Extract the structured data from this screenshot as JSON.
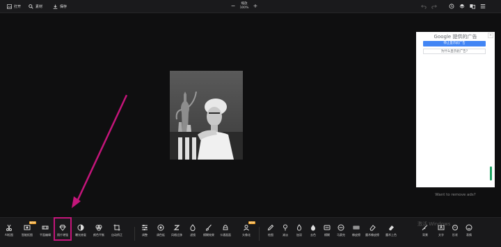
{
  "topbar": {
    "open_label": "打开",
    "material_label": "素材",
    "save_label": "保存",
    "zoom_label": "缩放",
    "zoom_value": "100%"
  },
  "ad": {
    "title": "Google 提供的广告",
    "stop_label": "停止显示此广告",
    "why_label": "为什么显示此广告?",
    "remove_text": "Want to remove ads?"
  },
  "toolbar": {
    "tools": [
      {
        "label": "AI抠图",
        "icon": "scissors-icon"
      },
      {
        "label": "智能抠图",
        "icon": "smart-cutout-icon",
        "badge": "NEW"
      },
      {
        "label": "平面编辑",
        "icon": "flat-edit-icon"
      },
      {
        "label": "照片增强",
        "icon": "diamond-icon"
      },
      {
        "label": "曝光修复",
        "icon": "exposure-icon"
      },
      {
        "label": "颜色平衡",
        "icon": "color-balance-icon"
      },
      {
        "label": "自动矫正",
        "icon": "crop-icon"
      },
      {
        "label": "调整",
        "icon": "sliders-icon"
      },
      {
        "label": "调色板",
        "icon": "palette-icon"
      },
      {
        "label": "风格迁移",
        "icon": "style-icon"
      },
      {
        "label": "滤镜",
        "icon": "drop-icon"
      },
      {
        "label": "模糊效果",
        "icon": "brush-icon"
      },
      {
        "label": "卡通画面",
        "icon": "cartoon-icon"
      },
      {
        "label": "头像化",
        "icon": "avatar-icon",
        "badge": "NEW"
      },
      {
        "label": "绘图",
        "icon": "pencil-icon"
      },
      {
        "label": "减淡",
        "icon": "dodge-icon"
      },
      {
        "label": "加深",
        "icon": "burn-icon"
      },
      {
        "label": "去色",
        "icon": "desaturate-icon"
      },
      {
        "label": "模糊",
        "icon": "blur-icon"
      },
      {
        "label": "马赛克",
        "icon": "mosaic-icon"
      },
      {
        "label": "橡皮擦",
        "icon": "eraser-icon"
      },
      {
        "label": "魔术橡皮擦",
        "icon": "magic-eraser-icon"
      },
      {
        "label": "魔术上色",
        "icon": "magic-color-icon"
      },
      {
        "label": "背景",
        "icon": "background-icon"
      },
      {
        "label": "文字",
        "icon": "text-icon"
      },
      {
        "label": "形状",
        "icon": "shape-icon"
      },
      {
        "label": "表情",
        "icon": "emoji-icon"
      }
    ]
  },
  "watermark": "激活 Windows"
}
